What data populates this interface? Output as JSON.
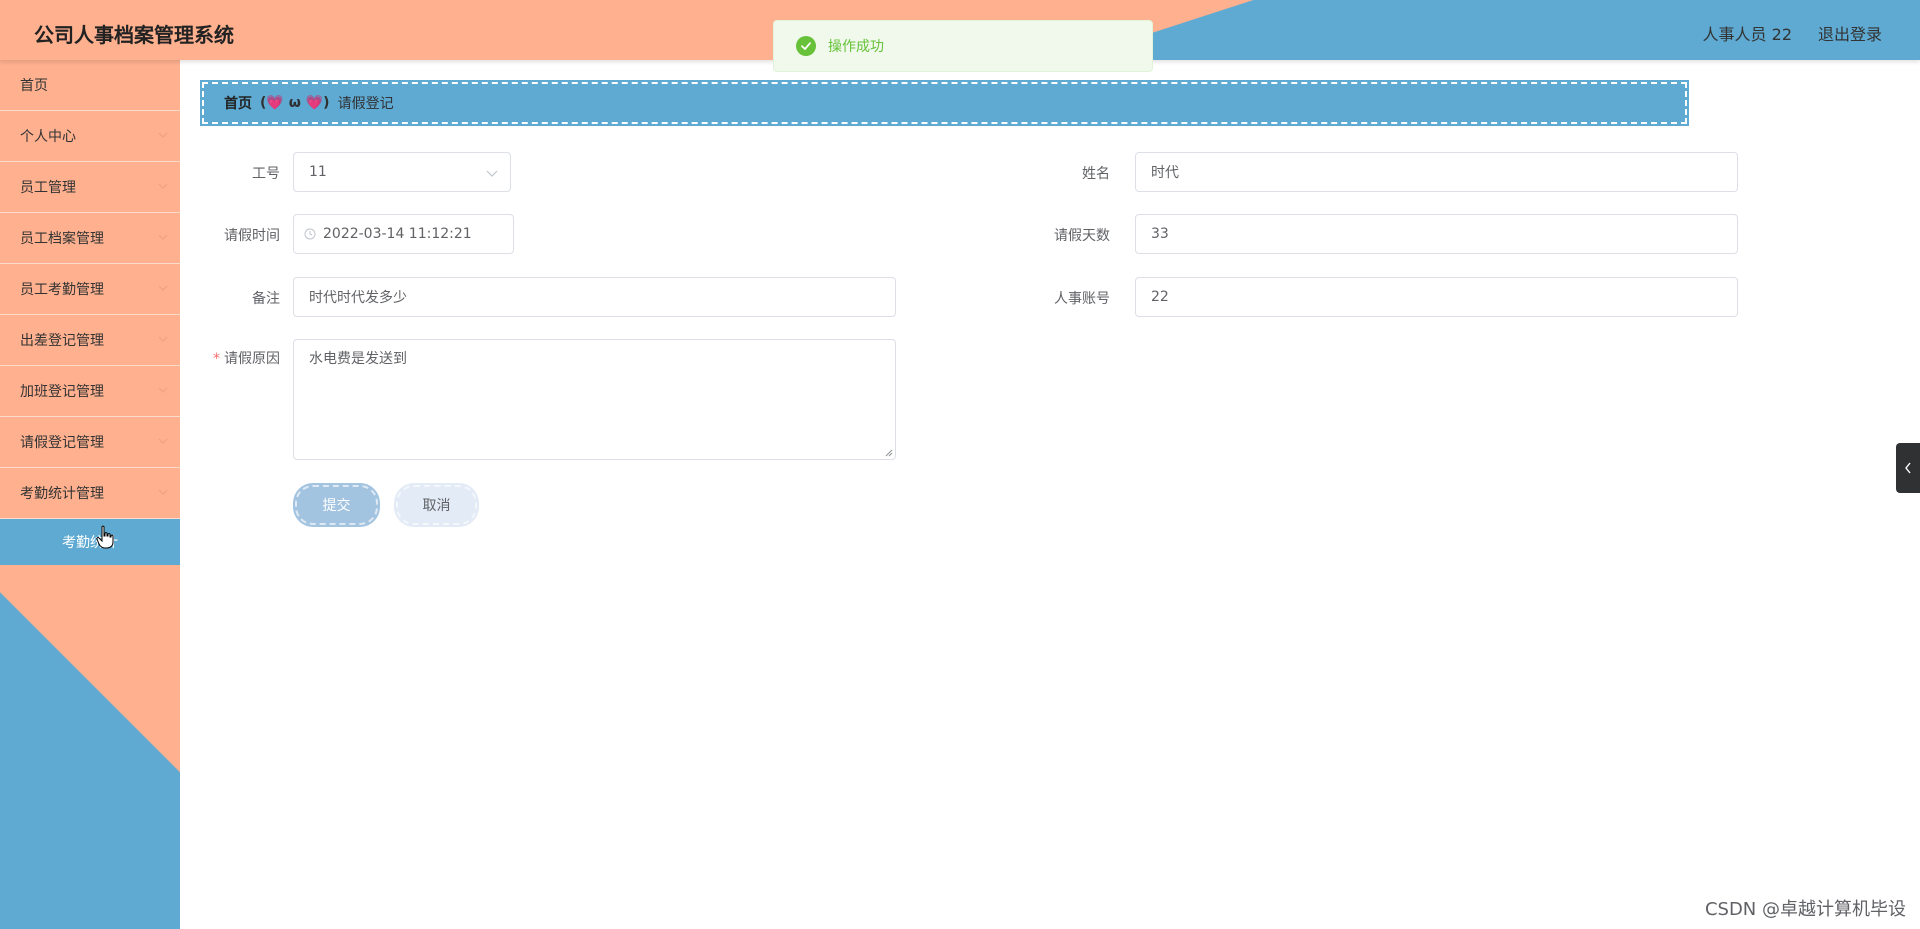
{
  "header": {
    "title": "公司人事档案管理系统",
    "user": "人事人员 22",
    "logout": "退出登录"
  },
  "toast": {
    "text": "操作成功",
    "type": "success",
    "color": "#67c23a"
  },
  "sidebar": {
    "items": [
      {
        "label": "首页",
        "has_chevron": false
      },
      {
        "label": "个人中心",
        "has_chevron": true
      },
      {
        "label": "员工管理",
        "has_chevron": true
      },
      {
        "label": "员工档案管理",
        "has_chevron": true
      },
      {
        "label": "员工考勤管理",
        "has_chevron": true
      },
      {
        "label": "出差登记管理",
        "has_chevron": true
      },
      {
        "label": "加班登记管理",
        "has_chevron": true
      },
      {
        "label": "请假登记管理",
        "has_chevron": true
      },
      {
        "label": "考勤统计管理",
        "has_chevron": true,
        "expanded": true
      }
    ],
    "active_sub_item": "考勤统计",
    "colors": {
      "primary": "#feb08f",
      "secondary": "#5eaad2"
    }
  },
  "breadcrumb": {
    "home": "首页",
    "separator": "(💗 ω 💗)",
    "current": "请假登记"
  },
  "form": {
    "employee_no": {
      "label": "工号",
      "value": "11"
    },
    "name": {
      "label": "姓名",
      "value": "时代"
    },
    "leave_time": {
      "label": "请假时间",
      "value": "2022-03-14 11:12:21"
    },
    "leave_days": {
      "label": "请假天数",
      "value": "33"
    },
    "remark": {
      "label": "备注",
      "value": "时代时代发多少"
    },
    "hr_account": {
      "label": "人事账号",
      "value": "22"
    },
    "leave_reason": {
      "label": "请假原因",
      "value": "水电费是发送到",
      "required": true
    }
  },
  "buttons": {
    "submit": "提交",
    "cancel": "取消"
  },
  "watermark": "CSDN @卓越计算机毕设"
}
